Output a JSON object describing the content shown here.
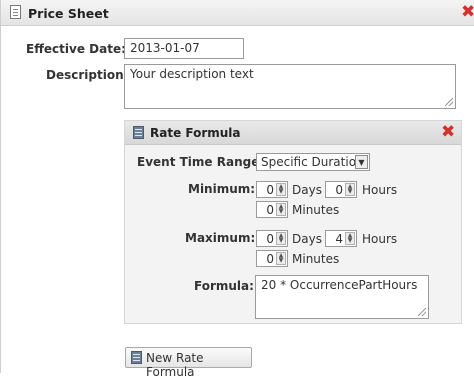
{
  "price_sheet": {
    "title": "Price Sheet",
    "effective_date_label": "Effective Date:",
    "effective_date_value": "2013-01-07",
    "description_label": "Description:",
    "description_value": "Your description text",
    "close_icon": "close-x-icon",
    "doc_icon": "document-icon"
  },
  "rate_formula": {
    "title": "Rate Formula",
    "icon": "calculator-icon",
    "close_icon": "close-x-icon",
    "event_time_range_label": "Event Time Range:",
    "event_time_range_value": "Specific Duration",
    "minimum_label": "Minimum:",
    "minimum": {
      "days": "0",
      "hours": "0",
      "minutes": "0"
    },
    "maximum_label": "Maximum:",
    "maximum": {
      "days": "0",
      "hours": "4",
      "minutes": "0"
    },
    "days_label": "Days",
    "hours_label": "Hours",
    "minutes_label": "Minutes",
    "formula_label": "Formula:",
    "formula_value": "20 * OccurrencePartHours"
  },
  "new_rate_formula_button": "New Rate Formula",
  "colors": {
    "close": "#d3322c",
    "panel_bg": "#f3f3f3",
    "header_bg": "#e4e4e4"
  }
}
